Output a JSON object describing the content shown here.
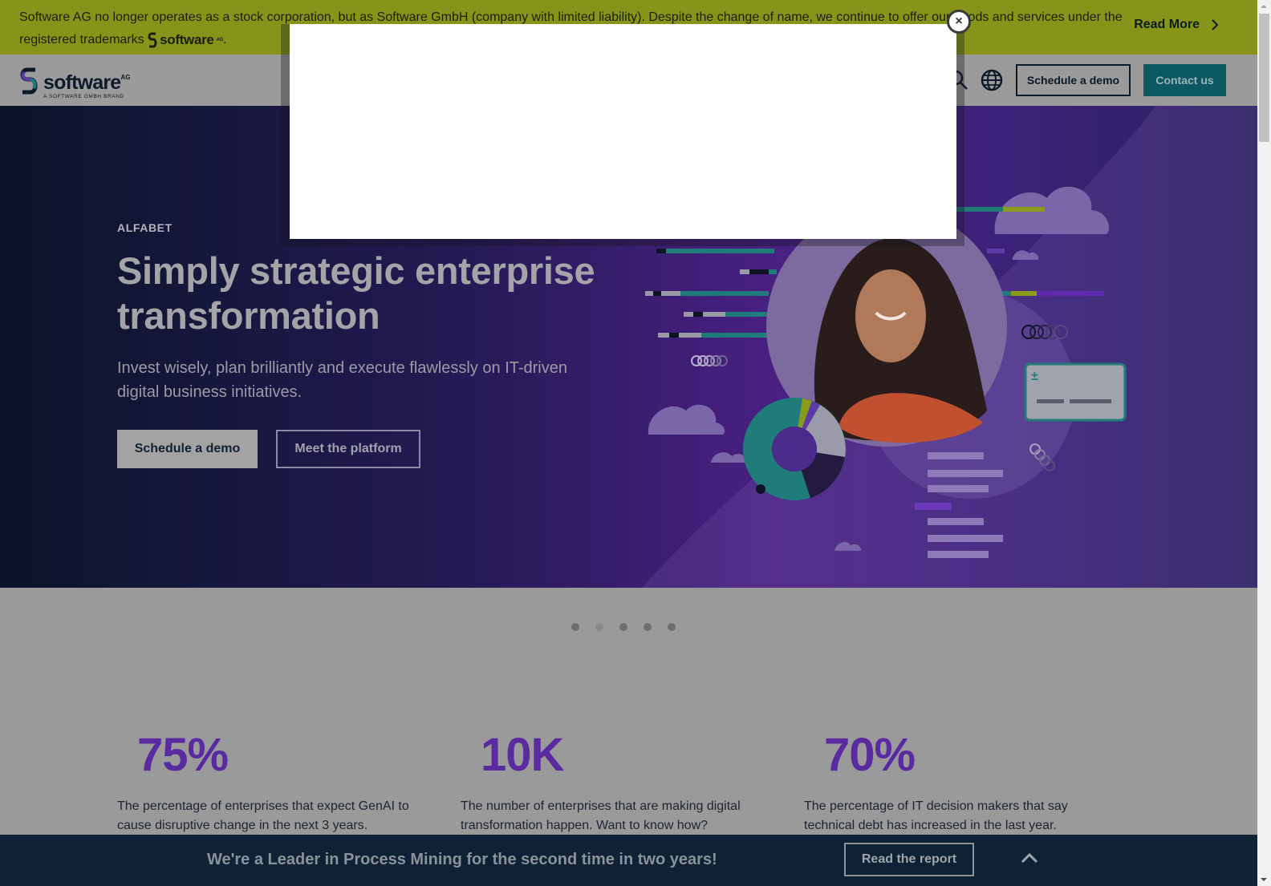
{
  "notice": {
    "text_before_logo": "Software AG no longer operates as a stock corporation, but as Software GmbH (company with limited liability). Despite the change of name, we continue to offer our goods and services under the registered trademarks",
    "logo_word": "software",
    "logo_sup": "AG",
    "text_after_logo": ".",
    "read_more": "Read More"
  },
  "header": {
    "logo_word": "software",
    "logo_sup": "AG",
    "logo_sub": "A SOFTWARE GMBH BRAND",
    "schedule_demo": "Schedule a demo",
    "contact_us": "Contact us"
  },
  "hero": {
    "eyebrow": "ALFABET",
    "title": "Simply strategic enterprise transformation",
    "subtitle": "Invest wisely, plan brilliantly and execute flawlessly on IT-driven digital business initiatives.",
    "primary_button": "Schedule a demo",
    "secondary_button": "Meet the platform"
  },
  "carousel": {
    "slide_count": 5,
    "active_index": 1
  },
  "stats": [
    {
      "value": "75%",
      "description": "The percentage of enterprises that expect GenAI to cause disruptive change in the next 3 years."
    },
    {
      "value": "10K",
      "description": "The number of enterprises that are making digital transformation happen. Want to know how?"
    },
    {
      "value": "70%",
      "description": "The percentage of IT decision makers that say technical debt has increased in the last year."
    }
  ],
  "bottom_bar": {
    "text": "We're a Leader in Process Mining for the second time in two years!",
    "button": "Read the report"
  },
  "modal": {
    "close_label": "×"
  },
  "colors": {
    "notice_bg": "#86951a",
    "brand_teal": "#0b5860",
    "stat_purple": "#5a2aa0",
    "bottom_bar_bg": "#0f2134"
  }
}
